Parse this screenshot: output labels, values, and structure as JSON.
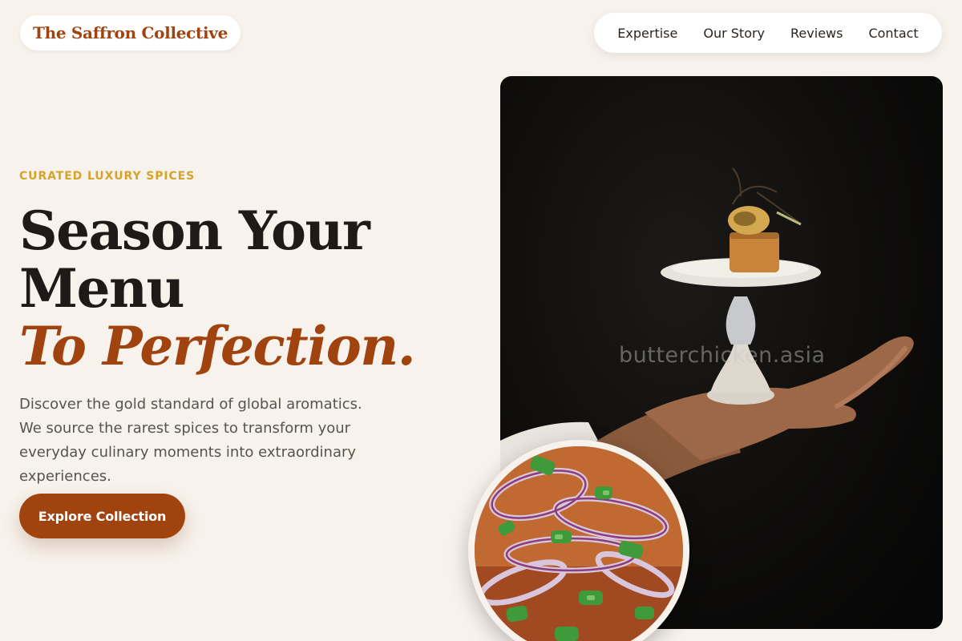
{
  "header": {
    "brand": "The Saffron Collective",
    "nav": [
      "Expertise",
      "Our Story",
      "Reviews",
      "Contact"
    ]
  },
  "hero": {
    "eyebrow": "CURATED LUXURY SPICES",
    "headline_line1": "Season Your",
    "headline_line2": "Menu",
    "headline_accent": "To Perfection.",
    "lead": "Discover the gold standard of global aromatics. We source the rarest spices to transform your everyday culinary moments into extraordinary experiences.",
    "cta_label": "Explore Collection",
    "image_watermark": "butterchicken.asia"
  },
  "colors": {
    "background": "#f7f2ec",
    "accent": "#a0430f",
    "gold": "#d4a429",
    "text": "#1f1a17"
  }
}
